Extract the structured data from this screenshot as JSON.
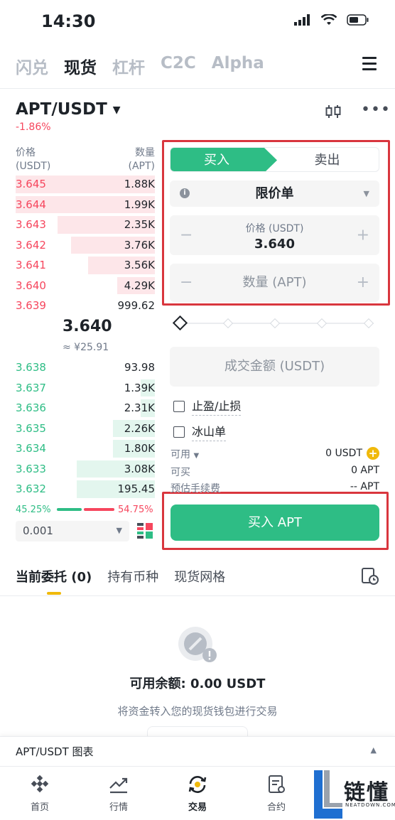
{
  "status": {
    "time": "14:30"
  },
  "topnav": {
    "items": [
      "闪兑",
      "现货",
      "杠杆",
      "C2C",
      "Alpha"
    ]
  },
  "pair": {
    "symbol": "APT/USDT",
    "change": "-1.86%"
  },
  "orderbook": {
    "price_header": "价格",
    "price_unit": "(USDT)",
    "qty_header": "数量",
    "qty_unit": "(APT)",
    "asks": [
      {
        "price": "3.645",
        "qty": "1.88K",
        "depth": 1.0
      },
      {
        "price": "3.644",
        "qty": "1.99K",
        "depth": 1.0
      },
      {
        "price": "3.643",
        "qty": "2.35K",
        "depth": 0.7
      },
      {
        "price": "3.642",
        "qty": "3.76K",
        "depth": 0.6
      },
      {
        "price": "3.641",
        "qty": "3.56K",
        "depth": 0.48
      },
      {
        "price": "3.640",
        "qty": "4.29K",
        "depth": 0.27
      },
      {
        "price": "3.639",
        "qty": "999.62",
        "depth": 0.0
      }
    ],
    "mid_price": "3.640",
    "mid_cny": "≈ ¥25.91",
    "bids": [
      {
        "price": "3.638",
        "qty": "93.98",
        "depth": 0.0
      },
      {
        "price": "3.637",
        "qty": "1.39K",
        "depth": 0.1
      },
      {
        "price": "3.636",
        "qty": "2.31K",
        "depth": 0.1
      },
      {
        "price": "3.635",
        "qty": "2.26K",
        "depth": 0.3
      },
      {
        "price": "3.634",
        "qty": "1.80K",
        "depth": 0.3
      },
      {
        "price": "3.633",
        "qty": "3.08K",
        "depth": 0.56
      },
      {
        "price": "3.632",
        "qty": "195.45",
        "depth": 0.56
      }
    ],
    "buy_ratio": "45.25%",
    "sell_ratio": "54.75%",
    "depth_value": "0.001"
  },
  "form": {
    "buy_tab": "买入",
    "sell_tab": "卖出",
    "order_type": "限价单",
    "price_label": "价格 (USDT)",
    "price_value": "3.640",
    "qty_placeholder": "数量 (APT)",
    "total_placeholder": "成交金额 (USDT)",
    "tp_sl": "止盈/止损",
    "iceberg": "冰山单",
    "available_label": "可用",
    "available_value": "0 USDT",
    "can_buy_label": "可买",
    "can_buy_value": "0 APT",
    "fee_label": "预估手续费",
    "fee_value": "-- APT",
    "buy_button": "买入 APT"
  },
  "lower_tabs": {
    "open_orders": "当前委托",
    "open_count": "(0)",
    "holdings": "持有币种",
    "grid": "现货网格"
  },
  "empty": {
    "balance": "可用余额: 0.00 USDT",
    "hint": "将资金转入您的现货钱包进行交易"
  },
  "chart_bar": {
    "label": "APT/USDT 图表"
  },
  "bottom_nav": {
    "items": [
      "首页",
      "行情",
      "交易",
      "合约"
    ]
  },
  "watermark": {
    "text": "链懂",
    "sub": "NEATDOWN.COM"
  },
  "colors": {
    "buy": "#2ebd85",
    "sell": "#f6465d",
    "highlight": "#d9363e",
    "accent": "#f0b90b"
  }
}
